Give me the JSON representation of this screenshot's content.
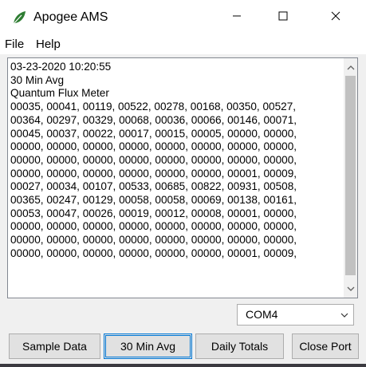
{
  "window": {
    "title": "Apogee AMS",
    "icon": "leaf-icon",
    "controls": [
      "minimize-icon",
      "maximize-icon",
      "close-icon"
    ]
  },
  "menu": {
    "items": [
      {
        "label": "File"
      },
      {
        "label": "Help"
      }
    ]
  },
  "output": {
    "lines": [
      "03-23-2020 10:20:55",
      "30 Min Avg",
      "Quantum Flux Meter",
      "00035, 00041, 00119, 00522, 00278, 00168, 00350, 00527,",
      "00364, 00297, 00329, 00068, 00036, 00066, 00146, 00071,",
      "00045, 00037, 00022, 00017, 00015, 00005, 00000, 00000,",
      "00000, 00000, 00000, 00000, 00000, 00000, 00000, 00000,",
      "00000, 00000, 00000, 00000, 00000, 00000, 00000, 00000,",
      "00000, 00000, 00000, 00000, 00000, 00000, 00001, 00009,",
      "00027, 00034, 00107, 00533, 00685, 00822, 00931, 00508,",
      "00365, 00247, 00129, 00058, 00058, 00069, 00138, 00161,",
      "00053, 00047, 00026, 00019, 00012, 00008, 00001, 00000,",
      "00000, 00000, 00000, 00000, 00000, 00000, 00000, 00000,",
      "00000, 00000, 00000, 00000, 00000, 00000, 00000, 00000,",
      "00000, 00000, 00000, 00000, 00000, 00000, 00001, 00009,"
    ]
  },
  "port": {
    "selected": "COM4"
  },
  "buttons": {
    "sample_data": "Sample Data",
    "avg_30_min": "30 Min Avg",
    "daily_totals": "Daily Totals",
    "close_port": "Close Port"
  },
  "colors": {
    "leaf": "#2e7d32",
    "focus_border": "#0078d7",
    "button_face": "#e1e1e1",
    "scroll_thumb": "#c1c1c1"
  }
}
